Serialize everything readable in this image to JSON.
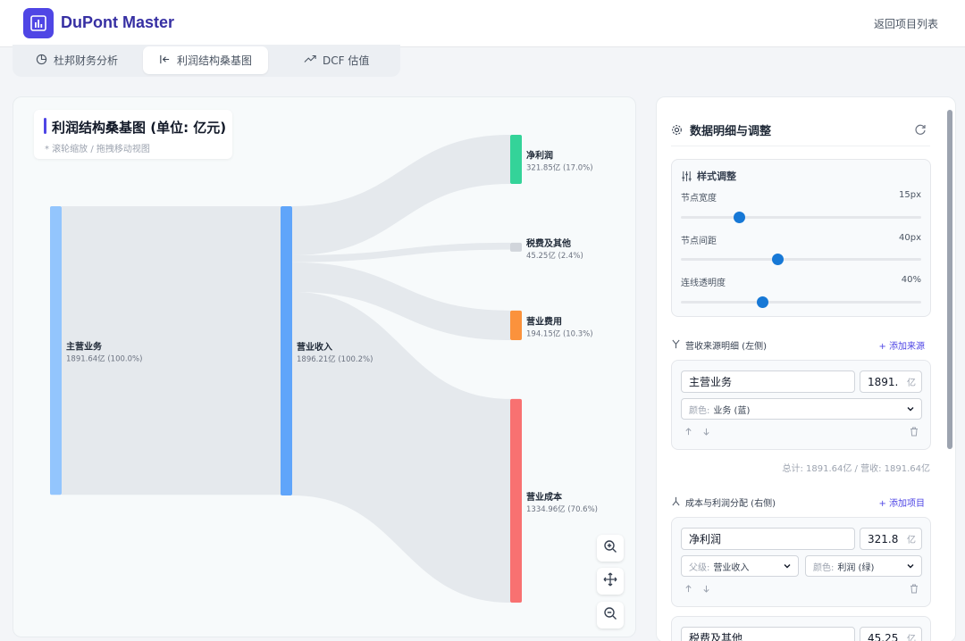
{
  "app": {
    "title": "DuPont Master",
    "back_label": "返回项目列表"
  },
  "tabs": [
    {
      "label": "杜邦财务分析",
      "icon": "pie-chart-icon",
      "active": false
    },
    {
      "label": "利润结构桑基图",
      "icon": "sankey-icon",
      "active": true
    },
    {
      "label": "DCF 估值",
      "icon": "trending-up-icon",
      "active": false
    }
  ],
  "chart": {
    "title": "利润结构桑基图 (单位: 亿元)",
    "hint": "* 滚轮缩放 / 拖拽移动视图"
  },
  "chart_data": {
    "type": "sankey",
    "unit": "亿",
    "nodes": [
      {
        "id": "main_business",
        "name": "主营业务",
        "value": 1891.64,
        "pct": "100.0%",
        "column": 0,
        "color": "#93c5fd"
      },
      {
        "id": "revenue",
        "name": "营业收入",
        "value": 1896.21,
        "pct": "100.2%",
        "column": 1,
        "color": "#60a5fa"
      },
      {
        "id": "net_profit",
        "name": "净利润",
        "value": 321.85,
        "pct": "17.0%",
        "column": 2,
        "color": "#34d399"
      },
      {
        "id": "tax_other",
        "name": "税费及其他",
        "value": 45.25,
        "pct": "2.4%",
        "column": 2,
        "color": "#d1d5db"
      },
      {
        "id": "opex",
        "name": "营业费用",
        "value": 194.15,
        "pct": "10.3%",
        "column": 2,
        "color": "#fb923c"
      },
      {
        "id": "cost",
        "name": "营业成本",
        "value": 1334.96,
        "pct": "70.6%",
        "column": 2,
        "color": "#f87171"
      }
    ],
    "links": [
      {
        "source": "main_business",
        "target": "revenue",
        "value": 1891.64
      },
      {
        "source": "revenue",
        "target": "net_profit",
        "value": 321.85
      },
      {
        "source": "revenue",
        "target": "tax_other",
        "value": 45.25
      },
      {
        "source": "revenue",
        "target": "opex",
        "value": 194.15
      },
      {
        "source": "revenue",
        "target": "cost",
        "value": 1334.96
      }
    ]
  },
  "zoom_controls": [
    {
      "name": "zoom-in",
      "icon": "zoom-in-icon"
    },
    {
      "name": "pan",
      "icon": "move-icon"
    },
    {
      "name": "zoom-out",
      "icon": "zoom-out-icon"
    }
  ],
  "side": {
    "title": "数据明细与调整",
    "style_panel": {
      "title": "样式调整",
      "sliders": [
        {
          "label": "节点宽度",
          "value": "15px",
          "level": 0.24
        },
        {
          "label": "节点间距",
          "value": "40px",
          "level": 0.4
        },
        {
          "label": "连线透明度",
          "value": "40%",
          "level": 0.34
        }
      ]
    },
    "revenue_section": {
      "label": "营收来源明细 (左侧)",
      "add_label": "+ 添加来源",
      "items": [
        {
          "name": "主营业务",
          "value": "1891.",
          "unit": "亿",
          "color_prefix": "颜色:",
          "color_value": "业务 (蓝)"
        }
      ],
      "total_line": "总计: 1891.64亿 / 营收: 1891.64亿"
    },
    "cost_section": {
      "label": "成本与利润分配 (右侧)",
      "add_label": "+ 添加项目",
      "items": [
        {
          "name": "净利润",
          "value": "321.8",
          "unit": "亿",
          "parent_prefix": "父级:",
          "parent_value": "营业收入",
          "color_prefix": "颜色:",
          "color_value": "利润 (绿)"
        },
        {
          "name": "税费及其他",
          "value": "45.25",
          "unit": "亿"
        }
      ]
    }
  },
  "colors": {
    "accent": "#4f46e5",
    "slider": "#1778d6"
  }
}
